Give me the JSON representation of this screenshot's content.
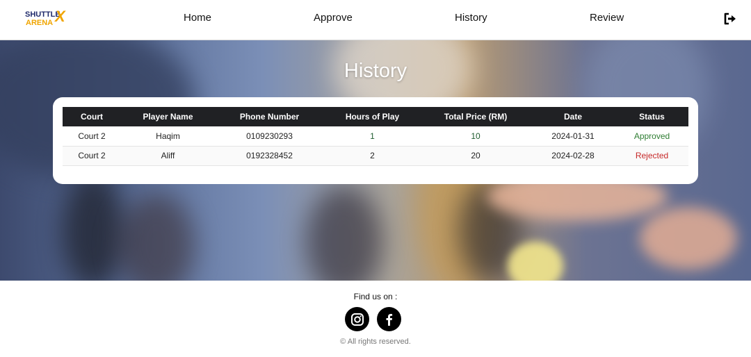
{
  "brand": {
    "line1": "SHUTTLE",
    "line2": "ARENA",
    "mark": "X",
    "colors": {
      "navy": "#1f2a6b",
      "gold": "#f0a500"
    }
  },
  "nav": {
    "items": [
      {
        "label": "Home"
      },
      {
        "label": "Approve"
      },
      {
        "label": "History"
      },
      {
        "label": "Review"
      }
    ],
    "logout_icon": "logout-icon"
  },
  "page": {
    "title": "History"
  },
  "table": {
    "headers": [
      "Court",
      "Player Name",
      "Phone Number",
      "Hours of Play",
      "Total Price (RM)",
      "Date",
      "Status"
    ],
    "rows": [
      {
        "court": "Court 2",
        "player": "Haqim",
        "phone": "0109230293",
        "hours": "1",
        "price": "10",
        "date": "2024-01-31",
        "status": "Approved"
      },
      {
        "court": "Court 2",
        "player": "Aliff",
        "phone": "0192328452",
        "hours": "2",
        "price": "20",
        "date": "2024-02-28",
        "status": "Rejected"
      }
    ],
    "status_colors": {
      "Approved": "#2e7d32",
      "Rejected": "#c62828"
    }
  },
  "footer": {
    "find_us": "Find us on :",
    "social": [
      {
        "icon": "instagram-icon"
      },
      {
        "icon": "facebook-icon"
      }
    ],
    "copyright": "© All rights reserved."
  }
}
